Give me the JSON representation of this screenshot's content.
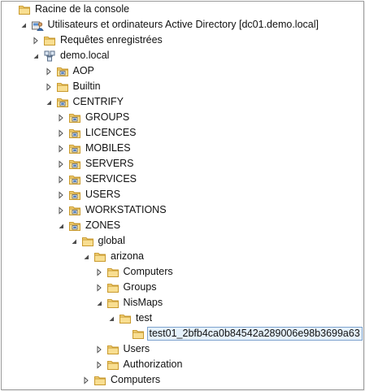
{
  "tree": {
    "nodes": [
      {
        "id": "root",
        "label": "Racine de la console",
        "level": 0,
        "toggle": "none",
        "icon": "console-root-icon"
      },
      {
        "id": "aduc",
        "label": "Utilisateurs et ordinateurs Active Directory [dc01.demo.local]",
        "level": 1,
        "toggle": "expanded",
        "icon": "aduc-icon"
      },
      {
        "id": "saved-queries",
        "label": "Requêtes enregistrées",
        "level": 2,
        "toggle": "collapsed",
        "icon": "folder-icon"
      },
      {
        "id": "domain",
        "label": "demo.local",
        "level": 2,
        "toggle": "expanded",
        "icon": "domain-icon"
      },
      {
        "id": "aop",
        "label": "AOP",
        "level": 3,
        "toggle": "collapsed",
        "icon": "ou-icon"
      },
      {
        "id": "builtin",
        "label": "Builtin",
        "level": 3,
        "toggle": "collapsed",
        "icon": "folder-icon"
      },
      {
        "id": "centrify",
        "label": "CENTRIFY",
        "level": 3,
        "toggle": "expanded",
        "icon": "ou-icon"
      },
      {
        "id": "groups",
        "label": "GROUPS",
        "level": 4,
        "toggle": "collapsed",
        "icon": "ou-icon"
      },
      {
        "id": "licences",
        "label": "LICENCES",
        "level": 4,
        "toggle": "collapsed",
        "icon": "ou-icon"
      },
      {
        "id": "mobiles",
        "label": "MOBILES",
        "level": 4,
        "toggle": "collapsed",
        "icon": "ou-icon"
      },
      {
        "id": "servers",
        "label": "SERVERS",
        "level": 4,
        "toggle": "collapsed",
        "icon": "ou-icon"
      },
      {
        "id": "services",
        "label": "SERVICES",
        "level": 4,
        "toggle": "collapsed",
        "icon": "ou-icon"
      },
      {
        "id": "users-ou",
        "label": "USERS",
        "level": 4,
        "toggle": "collapsed",
        "icon": "ou-icon"
      },
      {
        "id": "workstations",
        "label": "WORKSTATIONS",
        "level": 4,
        "toggle": "collapsed",
        "icon": "ou-icon"
      },
      {
        "id": "zones",
        "label": "ZONES",
        "level": 4,
        "toggle": "expanded",
        "icon": "ou-icon"
      },
      {
        "id": "global",
        "label": "global",
        "level": 5,
        "toggle": "expanded",
        "icon": "folder-icon"
      },
      {
        "id": "arizona",
        "label": "arizona",
        "level": 6,
        "toggle": "expanded",
        "icon": "folder-icon"
      },
      {
        "id": "computers-az",
        "label": "Computers",
        "level": 7,
        "toggle": "collapsed",
        "icon": "folder-icon"
      },
      {
        "id": "groups-az",
        "label": "Groups",
        "level": 7,
        "toggle": "collapsed",
        "icon": "folder-icon"
      },
      {
        "id": "nismaps",
        "label": "NisMaps",
        "level": 7,
        "toggle": "expanded",
        "icon": "folder-icon"
      },
      {
        "id": "test",
        "label": "test",
        "level": 8,
        "toggle": "expanded",
        "icon": "folder-icon"
      },
      {
        "id": "test01",
        "label": "test01_2bfb4ca0b84542a289006e98b3699a63",
        "level": 9,
        "toggle": "none",
        "icon": "folder-icon",
        "selected": true
      },
      {
        "id": "users-az",
        "label": "Users",
        "level": 7,
        "toggle": "collapsed",
        "icon": "folder-icon"
      },
      {
        "id": "authorization",
        "label": "Authorization",
        "level": 7,
        "toggle": "collapsed",
        "icon": "folder-icon"
      },
      {
        "id": "computers-global",
        "label": "Computers",
        "level": 6,
        "toggle": "collapsed",
        "icon": "folder-icon"
      }
    ]
  },
  "colors": {
    "folder_body": "#f3d27a",
    "folder_edge": "#c99a2e",
    "selection_bg": "#e5f1fb",
    "selection_border": "#7da2ce",
    "toggle_glyph": "#4d4d4d"
  }
}
